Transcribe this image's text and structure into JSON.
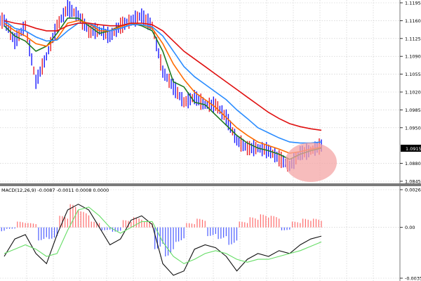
{
  "colors": {
    "background": "#ffffff",
    "grid": "#c8c8c8",
    "candle_up": "#1a1aff",
    "candle_down": "#e8202a",
    "ma_fast": "#1f7a1f",
    "ma_mid": "#ff6a00",
    "ma_slow": "#2a8cff",
    "ma_long": "#e01010",
    "hist_pos": "#ff6b6b",
    "hist_neg": "#4a5bff",
    "macd_line": "#111111",
    "signal_line": "#66dd66",
    "highlight": "#f4a6a6",
    "price_box_bg": "#000000"
  },
  "price_panel": {
    "current_price_label": "1.0915",
    "y_ticks": [
      "1.1195",
      "1.1160",
      "1.1125",
      "1.1090",
      "1.1055",
      "1.1020",
      "1.0985",
      "1.0950",
      "1.0880",
      "1.0845"
    ]
  },
  "macd_panel": {
    "indicator_label": "MACD(12,26,9) -0.0087 -0.0011 0.0008 0.0000",
    "y_ticks": [
      "0.0026",
      "0.00",
      "-0.0035"
    ]
  },
  "chart_data": [
    {
      "type": "line",
      "subtype": "candlestick_with_moving_averages",
      "ylim": [
        1.0845,
        1.1195
      ],
      "grid": true,
      "x": [
        0,
        1,
        2,
        3,
        4,
        5,
        6,
        7,
        8,
        9,
        10,
        11,
        12,
        13,
        14,
        15,
        16,
        17,
        18,
        19,
        20,
        21,
        22,
        23,
        24,
        25,
        26,
        27,
        28,
        29,
        30
      ],
      "close": [
        1.116,
        1.112,
        1.115,
        1.104,
        1.109,
        1.115,
        1.1185,
        1.117,
        1.114,
        1.114,
        1.113,
        1.115,
        1.116,
        1.117,
        1.115,
        1.106,
        1.103,
        1.1,
        1.101,
        1.0995,
        1.0995,
        1.097,
        1.0925,
        1.091,
        1.091,
        1.0905,
        1.089,
        1.0875,
        1.09,
        1.0905,
        1.0915
      ],
      "series": [
        {
          "name": "",
          "color_key": "ma_fast",
          "values": [
            1.115,
            1.113,
            1.112,
            1.11,
            1.111,
            1.1135,
            1.1165,
            1.1165,
            1.115,
            1.1135,
            1.114,
            1.115,
            1.1155,
            1.115,
            1.114,
            1.11,
            1.104,
            1.103,
            1.1,
            1.0995,
            1.0975,
            1.0955,
            1.0935,
            1.092,
            1.091,
            1.0905,
            1.0898,
            1.0888,
            1.0898,
            1.0905,
            1.091
          ]
        },
        {
          "name": "",
          "color_key": "ma_mid",
          "values": [
            1.1155,
            1.114,
            1.113,
            1.1115,
            1.111,
            1.1125,
            1.1155,
            1.116,
            1.1155,
            1.114,
            1.114,
            1.1148,
            1.1155,
            1.1152,
            1.1145,
            1.1115,
            1.1075,
            1.1045,
            1.102,
            1.1005,
            1.099,
            1.097,
            1.095,
            1.0935,
            1.0922,
            1.0915,
            1.0908,
            1.09,
            1.0903,
            1.0908,
            1.0912
          ]
        },
        {
          "name": "",
          "color_key": "ma_slow",
          "values": [
            1.116,
            1.1145,
            1.114,
            1.1128,
            1.112,
            1.1122,
            1.114,
            1.1155,
            1.1155,
            1.1145,
            1.114,
            1.1145,
            1.1152,
            1.1152,
            1.1148,
            1.113,
            1.11,
            1.107,
            1.105,
            1.1035,
            1.102,
            1.1005,
            1.0985,
            1.0968,
            1.095,
            1.094,
            1.093,
            1.0922,
            1.092,
            1.092,
            1.0922
          ]
        },
        {
          "name": "",
          "color_key": "ma_long",
          "values": [
            1.116,
            1.1155,
            1.1152,
            1.1145,
            1.114,
            1.114,
            1.115,
            1.1155,
            1.1155,
            1.1152,
            1.115,
            1.115,
            1.1155,
            1.1155,
            1.1152,
            1.114,
            1.112,
            1.11,
            1.1085,
            1.107,
            1.1055,
            1.104,
            1.1025,
            1.101,
            1.0995,
            1.098,
            1.0968,
            1.0958,
            1.0952,
            1.0948,
            1.0945
          ]
        }
      ]
    },
    {
      "type": "bar",
      "subtype": "macd_histogram_with_lines",
      "ylim": [
        -0.0035,
        0.0026
      ],
      "grid": true,
      "x": [
        0,
        1,
        2,
        3,
        4,
        5,
        6,
        7,
        8,
        9,
        10,
        11,
        12,
        13,
        14,
        15,
        16,
        17,
        18,
        19,
        20,
        21,
        22,
        23,
        24,
        25,
        26,
        27,
        28,
        29,
        30
      ],
      "histogram": [
        -0.0003,
        -0.0001,
        0.0004,
        0.0003,
        -0.0009,
        -0.0008,
        0.0008,
        0.0016,
        0.0011,
        0.0004,
        -0.0002,
        -0.0003,
        0.0005,
        0.0007,
        0.0004,
        -0.0015,
        -0.002,
        -0.001,
        0.0003,
        0.0006,
        -0.0006,
        -0.0008,
        -0.0012,
        0.0004,
        0.0007,
        0.0009,
        0.0008,
        -0.0002,
        0.0004,
        0.0006,
        0.0006
      ],
      "series": [
        {
          "name": "",
          "color_key": "macd_line",
          "values": [
            -0.002,
            -0.0008,
            -0.0005,
            -0.0018,
            -0.0025,
            -0.0005,
            0.0012,
            0.0016,
            0.0012,
            0.0,
            -0.0012,
            -0.0008,
            0.0005,
            0.0008,
            0.0002,
            -0.0025,
            -0.0033,
            -0.003,
            -0.0015,
            -0.0012,
            -0.0014,
            -0.002,
            -0.003,
            -0.0022,
            -0.0018,
            -0.002,
            -0.0016,
            -0.0018,
            -0.0012,
            -0.0008,
            -0.0006
          ]
        },
        {
          "name": "",
          "color_key": "signal_line",
          "values": [
            -0.0018,
            -0.0015,
            -0.0012,
            -0.0015,
            -0.002,
            -0.0018,
            -0.0002,
            0.0012,
            0.0014,
            0.0008,
            0.0,
            -0.0004,
            0.0,
            0.0004,
            0.0004,
            -0.001,
            -0.002,
            -0.0025,
            -0.0022,
            -0.0018,
            -0.0016,
            -0.0018,
            -0.0022,
            -0.0024,
            -0.0022,
            -0.0022,
            -0.002,
            -0.0018,
            -0.0016,
            -0.0013,
            -0.001
          ]
        }
      ]
    }
  ]
}
